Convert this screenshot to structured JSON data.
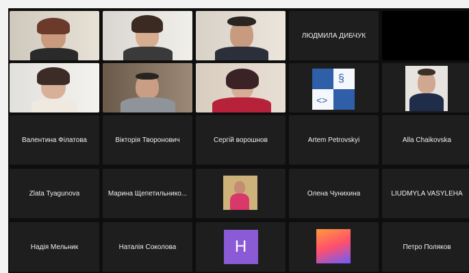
{
  "participants_row1": [
    "",
    "",
    "",
    "ЛЮДМИЛА ДИБЧУК",
    ""
  ],
  "participants_row3": [
    "Валентина Філатова",
    "Вікторія Творонович",
    "Сергій ворошнов",
    "Artem Petrovskyi",
    "Alla Chaikovska"
  ],
  "participants_row4": [
    "Zlata Tyagunova",
    "Марина Щепетильнико...",
    "",
    "Олена Чунихина",
    "LIUDMYLA VASYLEHA"
  ],
  "participants_row5": [
    "Надія Мельник",
    "Наталія Соколова",
    "",
    "",
    "Петро Поляков"
  ],
  "h_avatar_letter": "H",
  "colors": {
    "active_speaker": "#2fb14a",
    "tile_bg": "#1e1e1e",
    "app_bg": "#0e0e0e"
  }
}
